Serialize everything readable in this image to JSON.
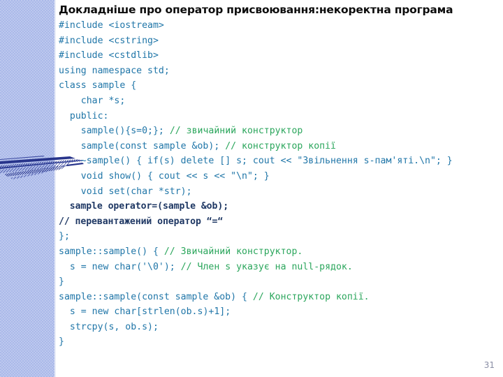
{
  "slide": {
    "title": "Докладніше про оператор присвоювання:некоректна програма",
    "page_number": "31",
    "colors": {
      "sidebar": "#aab9e9",
      "code": "#2076a8",
      "comment": "#2ba65c",
      "emphasis": "#1f3864",
      "title": "#0d0d0d",
      "page_number": "#8a8fa6",
      "background": "#ffffff"
    },
    "decoration": {
      "name": "hatched-fan-motif"
    }
  },
  "code": {
    "language": "cpp",
    "lines": [
      {
        "id": 1,
        "code": "#include <iostream>",
        "comment": "",
        "style": "normal"
      },
      {
        "id": 2,
        "code": "#include <cstring>",
        "comment": "",
        "style": "normal"
      },
      {
        "id": 3,
        "code": "#include <cstdlib>",
        "comment": "",
        "style": "normal"
      },
      {
        "id": 4,
        "code": "using namespace std;",
        "comment": "",
        "style": "normal"
      },
      {
        "id": 5,
        "code": "class sample {",
        "comment": "",
        "style": "normal"
      },
      {
        "id": 6,
        "code": "    char *s;",
        "comment": "",
        "style": "normal"
      },
      {
        "id": 7,
        "code": "  public:",
        "comment": "",
        "style": "normal"
      },
      {
        "id": 8,
        "code": "    sample(){s=0;}; ",
        "comment": "// звичайний конструктор",
        "style": "normal"
      },
      {
        "id": 9,
        "code": "    sample(const sample &ob); ",
        "comment": "// конструктор копії",
        "style": "normal"
      },
      {
        "id": 10,
        "code": "    ~sample() { if(s) delete [] s; cout << \"Звільнення s-пам'яті.\\n\"; }",
        "comment": "",
        "style": "normal"
      },
      {
        "id": 11,
        "code": "    void show() { cout << s << \"\\n\"; }",
        "comment": "",
        "style": "normal"
      },
      {
        "id": 12,
        "code": "    void set(char *str);",
        "comment": "",
        "style": "normal"
      },
      {
        "id": 13,
        "code": "  sample operator=(sample &ob);",
        "comment": "",
        "style": "navy"
      },
      {
        "id": 14,
        "code": "// перевантажений оператор “=“",
        "comment": "",
        "style": "navy"
      },
      {
        "id": 15,
        "code": "};",
        "comment": "",
        "style": "normal"
      },
      {
        "id": 16,
        "code": "sample::sample() { ",
        "comment": "// Звичайний конструктор.",
        "style": "normal"
      },
      {
        "id": 17,
        "code": "  s = new char('\\0'); ",
        "comment": "// Член s указує на null-рядок.",
        "style": "normal"
      },
      {
        "id": 18,
        "code": "}",
        "comment": "",
        "style": "normal"
      },
      {
        "id": 19,
        "code": "sample::sample(const sample &ob) { ",
        "comment": "// Конструктор копії.",
        "style": "normal"
      },
      {
        "id": 20,
        "code": "  s = new char[strlen(ob.s)+1];",
        "comment": "",
        "style": "normal"
      },
      {
        "id": 21,
        "code": "  strcpy(s, ob.s);",
        "comment": "",
        "style": "normal"
      },
      {
        "id": 22,
        "code": "}",
        "comment": "",
        "style": "normal"
      }
    ]
  }
}
